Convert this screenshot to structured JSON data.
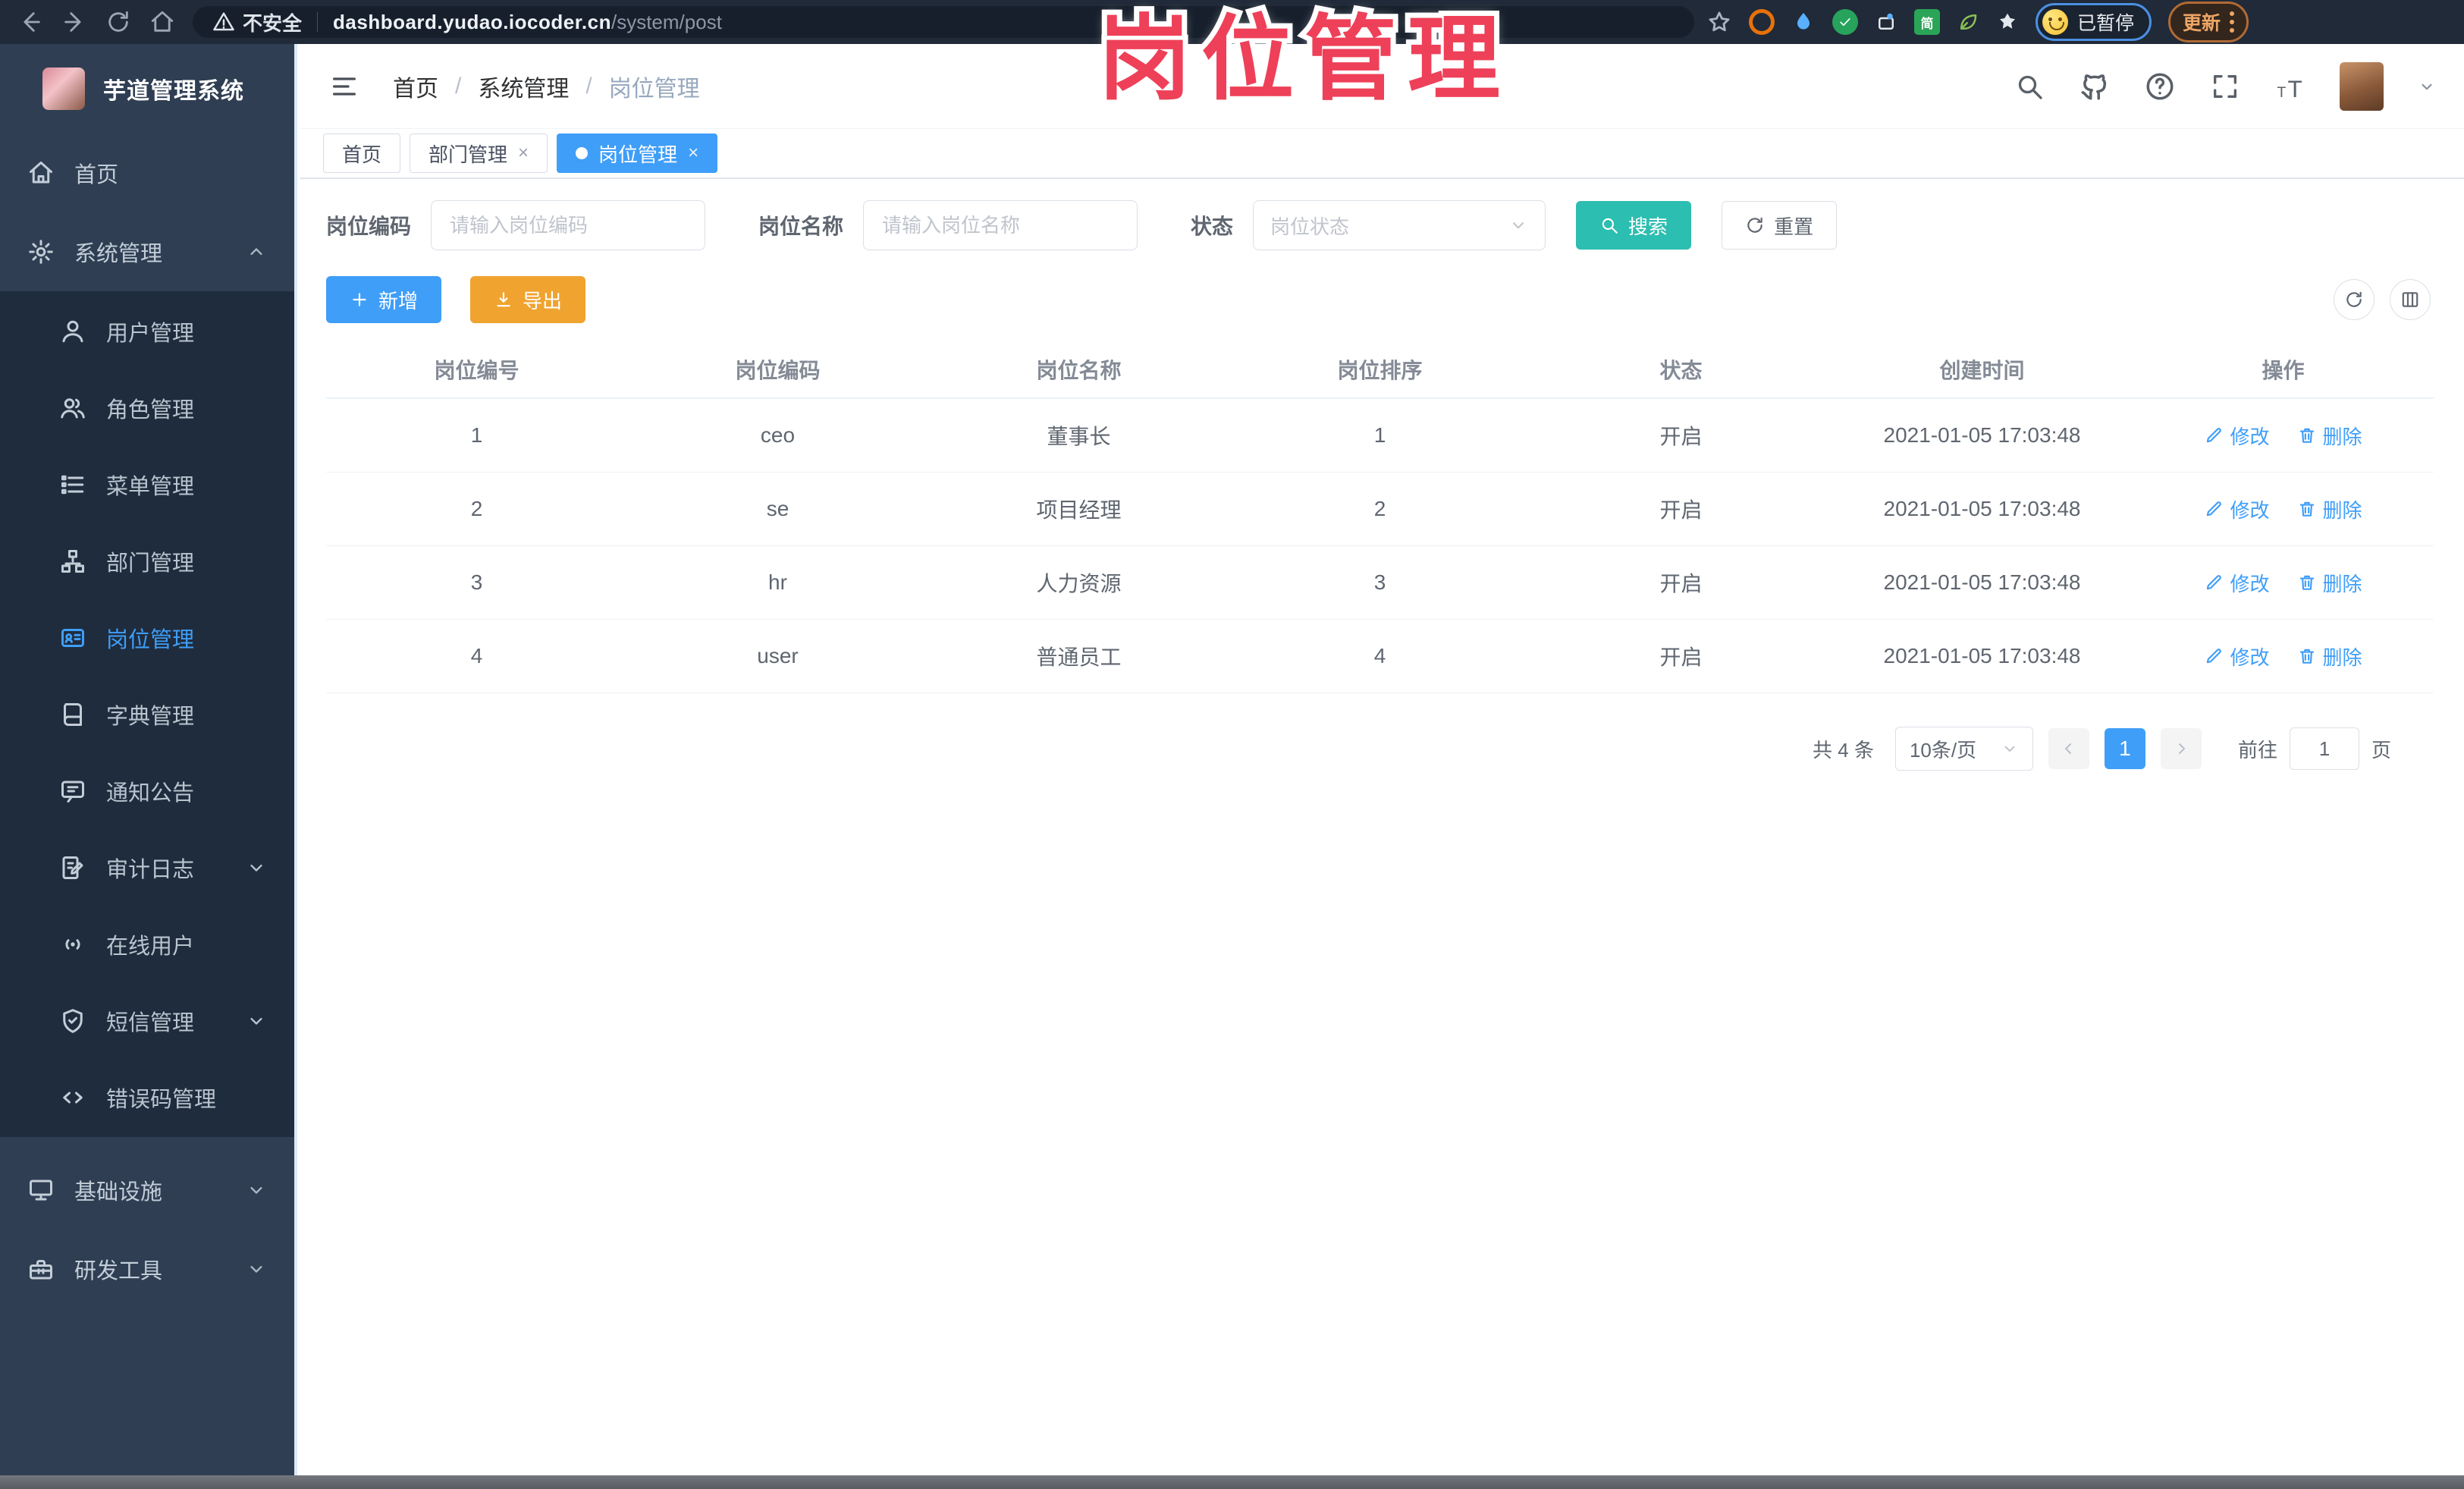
{
  "browser": {
    "security_label": "不安全",
    "url_host": "dashboard.yudao.iocoder.cn",
    "url_path": "/system/post",
    "paused_badge": "已暂停",
    "update_button": "更新",
    "extension_badge": "简"
  },
  "overlay": {
    "title": "岗位管理"
  },
  "sidebar": {
    "app_title": "芋道管理系统",
    "home_label": "首页",
    "system_label": "系统管理",
    "system_children": [
      {
        "label": "用户管理"
      },
      {
        "label": "角色管理"
      },
      {
        "label": "菜单管理"
      },
      {
        "label": "部门管理"
      },
      {
        "label": "岗位管理"
      },
      {
        "label": "字典管理"
      },
      {
        "label": "通知公告"
      },
      {
        "label": "审计日志"
      },
      {
        "label": "在线用户"
      },
      {
        "label": "短信管理"
      },
      {
        "label": "错误码管理"
      }
    ],
    "infra_label": "基础设施",
    "devtool_label": "研发工具"
  },
  "header": {
    "breadcrumb": [
      "首页",
      "系统管理",
      "岗位管理"
    ]
  },
  "tabs": [
    {
      "label": "首页"
    },
    {
      "label": "部门管理",
      "close": "×"
    },
    {
      "label": "岗位管理",
      "close": "×"
    }
  ],
  "filters": {
    "post_code_label": "岗位编码",
    "post_code_placeholder": "请输入岗位编码",
    "post_name_label": "岗位名称",
    "post_name_placeholder": "请输入岗位名称",
    "status_label": "状态",
    "status_placeholder": "岗位状态",
    "search_button": "搜索",
    "reset_button": "重置"
  },
  "toolbar": {
    "add_button": "新增",
    "export_button": "导出"
  },
  "table": {
    "columns": [
      "岗位编号",
      "岗位编码",
      "岗位名称",
      "岗位排序",
      "状态",
      "创建时间",
      "操作"
    ],
    "rows": [
      {
        "id": "1",
        "code": "ceo",
        "name": "董事长",
        "sort": "1",
        "status": "开启",
        "created": "2021-01-05 17:03:48"
      },
      {
        "id": "2",
        "code": "se",
        "name": "项目经理",
        "sort": "2",
        "status": "开启",
        "created": "2021-01-05 17:03:48"
      },
      {
        "id": "3",
        "code": "hr",
        "name": "人力资源",
        "sort": "3",
        "status": "开启",
        "created": "2021-01-05 17:03:48"
      },
      {
        "id": "4",
        "code": "user",
        "name": "普通员工",
        "sort": "4",
        "status": "开启",
        "created": "2021-01-05 17:03:48"
      }
    ],
    "edit_label": "修改",
    "delete_label": "删除"
  },
  "pagination": {
    "total_label": "共 4 条",
    "page_size": "10条/页",
    "current_page": "1",
    "goto_label": "前往",
    "goto_value": "1",
    "page_unit": "页"
  },
  "colors": {
    "accent_blue": "#3f9ef8",
    "teal": "#2cbeb0",
    "warning_orange": "#f0a32f",
    "overlay_pink": "#ee4058",
    "sidebar_bg": "#2f3e53",
    "submenu_bg": "#1f2c3d"
  }
}
